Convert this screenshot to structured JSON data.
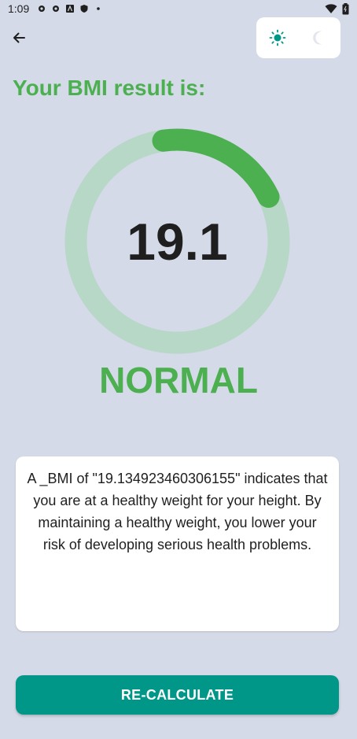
{
  "status_bar": {
    "time": "1:09",
    "icons": [
      "settings-icon",
      "settings-icon",
      "a-icon",
      "shield-icon",
      "dot-icon"
    ],
    "right_icons": [
      "wifi-icon",
      "battery-icon"
    ]
  },
  "header": {
    "back_icon": "arrow-back-icon",
    "theme_options": [
      "light-mode-icon",
      "dark-mode-icon"
    ],
    "theme_selected": "light"
  },
  "result": {
    "title": "Your BMI result is:",
    "value": "19.1",
    "category": "NORMAL",
    "gauge_fraction": 0.2
  },
  "info": {
    "text": "A _BMI of \"19.134923460306155\" indicates that you are at a healthy weight for your height. By maintaining a healthy weight, you lower your risk of developing serious health problems."
  },
  "actions": {
    "recalculate_label": "RE-CALCULATE"
  },
  "colors": {
    "background": "#d4dae7",
    "accent_green": "#4caf50",
    "track_green": "#b7d7c7",
    "teal": "#009688",
    "card": "#ffffff"
  }
}
